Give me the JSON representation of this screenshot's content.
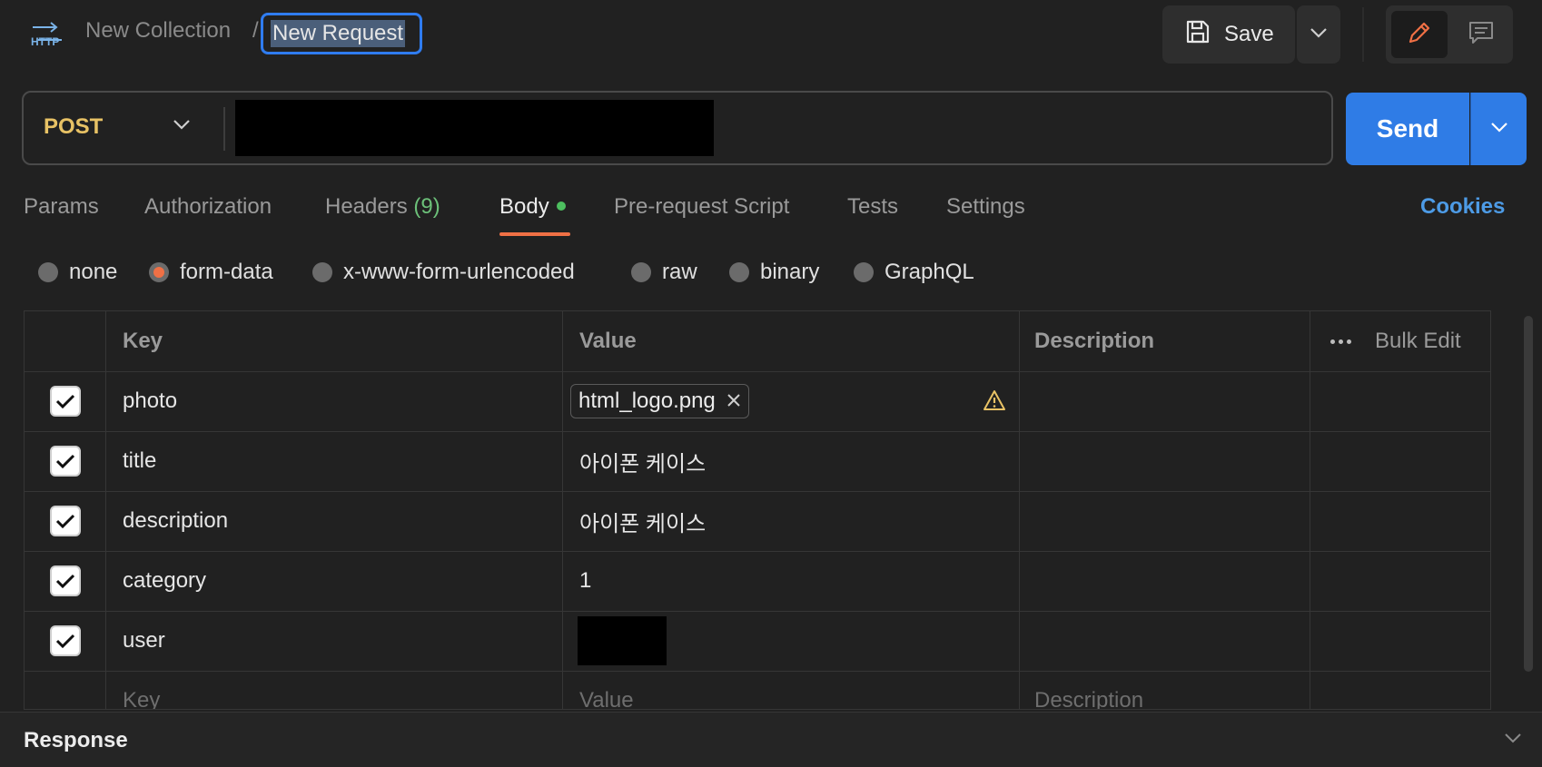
{
  "breadcrumb": {
    "collection": "New Collection",
    "separator": "/",
    "request_name": "New Request"
  },
  "toolbar": {
    "save_label": "Save"
  },
  "request": {
    "method": "POST",
    "send_label": "Send"
  },
  "tabs": {
    "params": "Params",
    "authorization": "Authorization",
    "headers": "Headers",
    "headers_count": "(9)",
    "body": "Body",
    "prerequest": "Pre-request Script",
    "tests": "Tests",
    "settings": "Settings",
    "cookies": "Cookies"
  },
  "body_types": {
    "selected": "form-data",
    "options": [
      "none",
      "form-data",
      "x-www-form-urlencoded",
      "raw",
      "binary",
      "GraphQL"
    ]
  },
  "table": {
    "headers": {
      "key": "Key",
      "value": "Value",
      "description": "Description",
      "bulk_edit": "Bulk Edit"
    },
    "rows": [
      {
        "key": "photo",
        "value": "html_logo.png",
        "checked": true
      },
      {
        "key": "title",
        "value": "아이폰 케이스",
        "checked": true
      },
      {
        "key": "description",
        "value": "아이폰 케이스",
        "checked": true
      },
      {
        "key": "category",
        "value": "1",
        "checked": true
      },
      {
        "key": "user",
        "value": "",
        "checked": true
      }
    ],
    "placeholders": {
      "key": "Key",
      "value": "Value",
      "description": "Description"
    }
  },
  "response": {
    "label": "Response"
  },
  "colors": {
    "accent_blue": "#2f7ce6",
    "method_color": "#e8c265",
    "active_tab_underline": "#f07045",
    "body_dot": "#4dbf5f",
    "headers_count": "#6cc079",
    "cookies_link": "#4d9be6"
  },
  "icons": [
    "http-icon",
    "save-icon",
    "chevron-down-icon",
    "pencil-icon",
    "comment-icon",
    "close-icon",
    "warning-icon",
    "more-icon",
    "checkmark-icon"
  ]
}
